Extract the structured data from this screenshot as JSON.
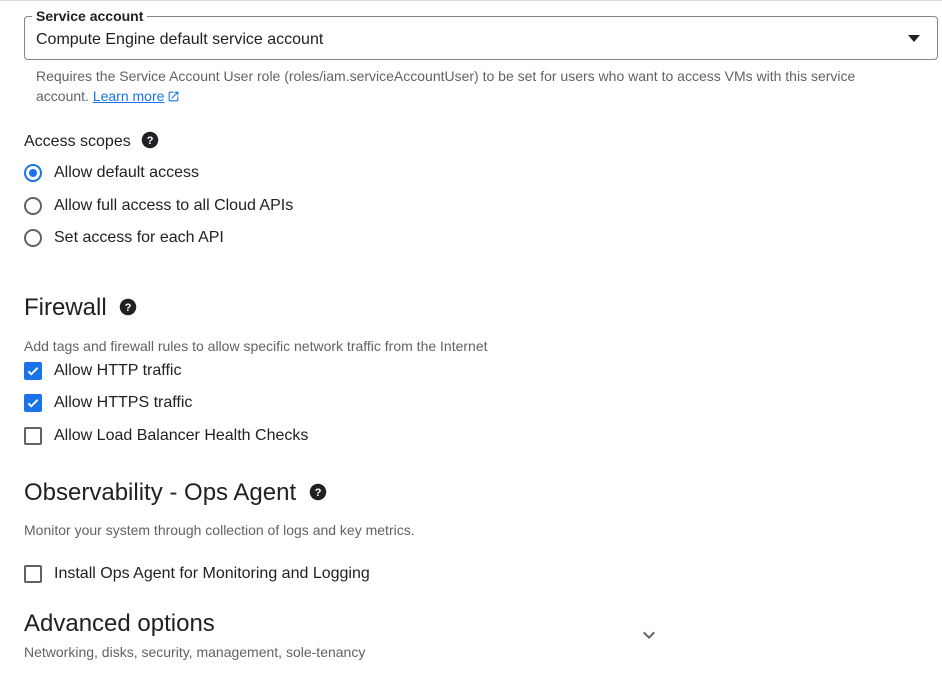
{
  "service_account": {
    "label": "Service account",
    "value": "Compute Engine default service account",
    "help_text": "Requires the Service Account User role (roles/iam.serviceAccountUser) to be set for users who want to access VMs with this service account.",
    "learn_more": "Learn more"
  },
  "access_scopes": {
    "title": "Access scopes",
    "options": [
      {
        "label": "Allow default access",
        "selected": true
      },
      {
        "label": "Allow full access to all Cloud APIs",
        "selected": false
      },
      {
        "label": "Set access for each API",
        "selected": false
      }
    ]
  },
  "firewall": {
    "title": "Firewall",
    "description": "Add tags and firewall rules to allow specific network traffic from the Internet",
    "options": [
      {
        "label": "Allow HTTP traffic",
        "checked": true
      },
      {
        "label": "Allow HTTPS traffic",
        "checked": true
      },
      {
        "label": "Allow Load Balancer Health Checks",
        "checked": false
      }
    ]
  },
  "observability": {
    "title": "Observability - Ops Agent",
    "description": "Monitor your system through collection of logs and key metrics.",
    "option": {
      "label": "Install Ops Agent for Monitoring and Logging",
      "checked": false
    }
  },
  "advanced": {
    "title": "Advanced options",
    "description": "Networking, disks, security, management, sole-tenancy"
  },
  "colors": {
    "accent": "#1a73e8",
    "text": "#202124",
    "secondary_text": "#5f6368"
  },
  "icons": {
    "dropdown": "caret-down-icon",
    "help": "help-circle-icon",
    "external_link": "open-in-new-icon",
    "expand": "chevron-down-icon"
  }
}
